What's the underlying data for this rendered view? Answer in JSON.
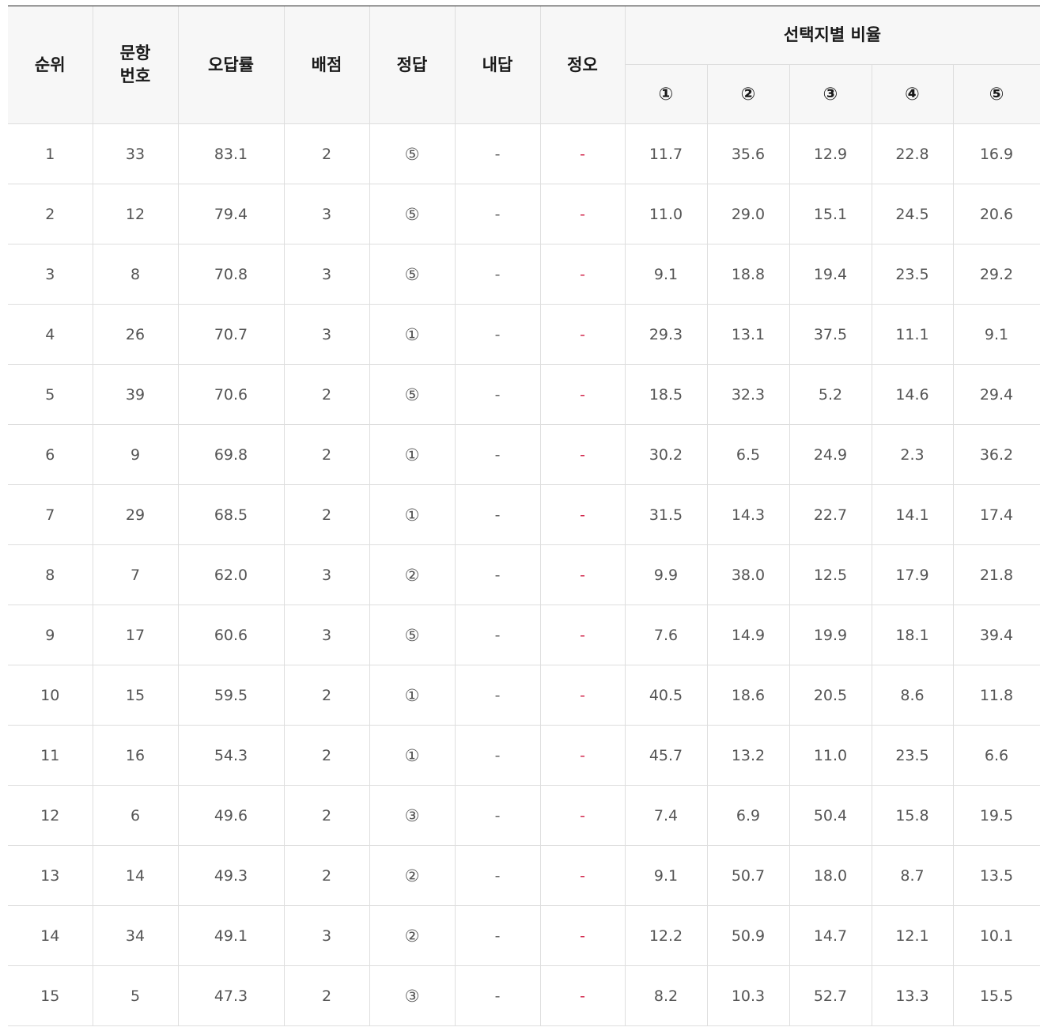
{
  "table": {
    "headers": {
      "rank": "순위",
      "item_no_line1": "문항",
      "item_no_line2": "번호",
      "error_rate": "오답률",
      "points": "배점",
      "answer": "정답",
      "my_answer": "내답",
      "ox": "정오",
      "choice_ratio": "선택지별 비율",
      "choices": [
        "①",
        "②",
        "③",
        "④",
        "⑤"
      ]
    },
    "rows": [
      {
        "rank": "1",
        "item_no": "33",
        "error_rate": "83.1",
        "points": "2",
        "answer": "⑤",
        "my_answer": "-",
        "ox": "-",
        "ratios": [
          "11.7",
          "35.6",
          "12.9",
          "22.8",
          "16.9"
        ]
      },
      {
        "rank": "2",
        "item_no": "12",
        "error_rate": "79.4",
        "points": "3",
        "answer": "⑤",
        "my_answer": "-",
        "ox": "-",
        "ratios": [
          "11.0",
          "29.0",
          "15.1",
          "24.5",
          "20.6"
        ]
      },
      {
        "rank": "3",
        "item_no": "8",
        "error_rate": "70.8",
        "points": "3",
        "answer": "⑤",
        "my_answer": "-",
        "ox": "-",
        "ratios": [
          "9.1",
          "18.8",
          "19.4",
          "23.5",
          "29.2"
        ]
      },
      {
        "rank": "4",
        "item_no": "26",
        "error_rate": "70.7",
        "points": "3",
        "answer": "①",
        "my_answer": "-",
        "ox": "-",
        "ratios": [
          "29.3",
          "13.1",
          "37.5",
          "11.1",
          "9.1"
        ]
      },
      {
        "rank": "5",
        "item_no": "39",
        "error_rate": "70.6",
        "points": "2",
        "answer": "⑤",
        "my_answer": "-",
        "ox": "-",
        "ratios": [
          "18.5",
          "32.3",
          "5.2",
          "14.6",
          "29.4"
        ]
      },
      {
        "rank": "6",
        "item_no": "9",
        "error_rate": "69.8",
        "points": "2",
        "answer": "①",
        "my_answer": "-",
        "ox": "-",
        "ratios": [
          "30.2",
          "6.5",
          "24.9",
          "2.3",
          "36.2"
        ]
      },
      {
        "rank": "7",
        "item_no": "29",
        "error_rate": "68.5",
        "points": "2",
        "answer": "①",
        "my_answer": "-",
        "ox": "-",
        "ratios": [
          "31.5",
          "14.3",
          "22.7",
          "14.1",
          "17.4"
        ]
      },
      {
        "rank": "8",
        "item_no": "7",
        "error_rate": "62.0",
        "points": "3",
        "answer": "②",
        "my_answer": "-",
        "ox": "-",
        "ratios": [
          "9.9",
          "38.0",
          "12.5",
          "17.9",
          "21.8"
        ]
      },
      {
        "rank": "9",
        "item_no": "17",
        "error_rate": "60.6",
        "points": "3",
        "answer": "⑤",
        "my_answer": "-",
        "ox": "-",
        "ratios": [
          "7.6",
          "14.9",
          "19.9",
          "18.1",
          "39.4"
        ]
      },
      {
        "rank": "10",
        "item_no": "15",
        "error_rate": "59.5",
        "points": "2",
        "answer": "①",
        "my_answer": "-",
        "ox": "-",
        "ratios": [
          "40.5",
          "18.6",
          "20.5",
          "8.6",
          "11.8"
        ]
      },
      {
        "rank": "11",
        "item_no": "16",
        "error_rate": "54.3",
        "points": "2",
        "answer": "①",
        "my_answer": "-",
        "ox": "-",
        "ratios": [
          "45.7",
          "13.2",
          "11.0",
          "23.5",
          "6.6"
        ]
      },
      {
        "rank": "12",
        "item_no": "6",
        "error_rate": "49.6",
        "points": "2",
        "answer": "③",
        "my_answer": "-",
        "ox": "-",
        "ratios": [
          "7.4",
          "6.9",
          "50.4",
          "15.8",
          "19.5"
        ]
      },
      {
        "rank": "13",
        "item_no": "14",
        "error_rate": "49.3",
        "points": "2",
        "answer": "②",
        "my_answer": "-",
        "ox": "-",
        "ratios": [
          "9.1",
          "50.7",
          "18.0",
          "8.7",
          "13.5"
        ]
      },
      {
        "rank": "14",
        "item_no": "34",
        "error_rate": "49.1",
        "points": "3",
        "answer": "②",
        "my_answer": "-",
        "ox": "-",
        "ratios": [
          "12.2",
          "50.9",
          "14.7",
          "12.1",
          "10.1"
        ]
      },
      {
        "rank": "15",
        "item_no": "5",
        "error_rate": "47.3",
        "points": "2",
        "answer": "③",
        "my_answer": "-",
        "ox": "-",
        "ratios": [
          "8.2",
          "10.3",
          "52.7",
          "13.3",
          "15.5"
        ]
      }
    ]
  },
  "colors": {
    "header_bg": "#f7f7f7",
    "border": "#dedede",
    "ox_mark": "#d2294e",
    "top_rule": "#222222"
  }
}
